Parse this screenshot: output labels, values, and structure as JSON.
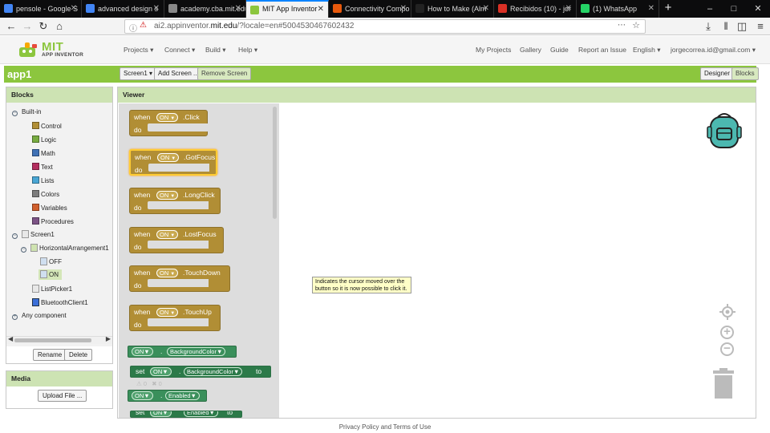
{
  "browser": {
    "tabs": [
      {
        "title": "pensole - Google S",
        "color": "#4285f4"
      },
      {
        "title": "advanced design s",
        "color": "#4285f4"
      },
      {
        "title": "academy.cba.mit.edu/cl",
        "color": "#888888"
      },
      {
        "title": "MIT App Inventor",
        "color": "#8cc63e"
      },
      {
        "title": "Connectivity Compo",
        "color": "#e8590c"
      },
      {
        "title": "How to Make (Alm",
        "color": "#222222"
      },
      {
        "title": "Recibidos (10) - jor",
        "color": "#d93025"
      },
      {
        "title": "(1) WhatsApp",
        "color": "#25d366"
      }
    ],
    "active_tab_index": 3,
    "url_prefix": "ai2.appinventor.",
    "url_domain": "mit.edu",
    "url_rest": "/?locale=en#5004530467602432"
  },
  "app": {
    "logo_mit": "MIT",
    "logo_sub": "APP INVENTOR",
    "menu": {
      "projects": "Projects ▾",
      "connect": "Connect ▾",
      "build": "Build ▾",
      "help": "Help ▾",
      "my_projects": "My Projects",
      "gallery": "Gallery",
      "guide": "Guide",
      "report": "Report an Issue",
      "language": "English ▾",
      "user": "jorgecorrea.id@gmail.com ▾"
    },
    "project_name": "app1",
    "screen_select": "Screen1 ▾",
    "add_screen": "Add Screen ...",
    "remove_screen": "Remove Screen",
    "designer": "Designer",
    "blocks": "Blocks"
  },
  "blocks_panel": {
    "title": "Blocks",
    "builtin_label": "Built-in",
    "builtin": [
      {
        "label": "Control",
        "color": "#b18e35"
      },
      {
        "label": "Logic",
        "color": "#77ab41"
      },
      {
        "label": "Math",
        "color": "#3f71b5"
      },
      {
        "label": "Text",
        "color": "#b32d5e"
      },
      {
        "label": "Lists",
        "color": "#49a6d4"
      },
      {
        "label": "Colors",
        "color": "#7d7d7d"
      },
      {
        "label": "Variables",
        "color": "#d05f2d"
      },
      {
        "label": "Procedures",
        "color": "#7c5385"
      }
    ],
    "screen": "Screen1",
    "arrangement": "HorizontalArrangement1",
    "off": "OFF",
    "on": "ON",
    "listpicker": "ListPicker1",
    "bluetooth": "BluetoothClient1",
    "any_component": "Any component",
    "rename": "Rename",
    "delete": "Delete"
  },
  "media_panel": {
    "title": "Media",
    "upload": "Upload File ..."
  },
  "viewer": {
    "title": "Viewer",
    "when": "when",
    "do": "do",
    "component": "ON",
    "events": [
      ".Click",
      ".GotFocus",
      ".LongClick",
      ".LostFocus",
      ".TouchDown",
      ".TouchUp"
    ],
    "tooltip": "Indicates the cursor moved over the button so it is now possible to click it.",
    "prop_background": "BackgroundColor",
    "set_label": "set",
    "to_label": "to",
    "prop_enabled": "Enabled",
    "dot": ".",
    "warn_count": "0",
    "error_count": "0"
  },
  "footer": "Privacy Policy and Terms of Use"
}
